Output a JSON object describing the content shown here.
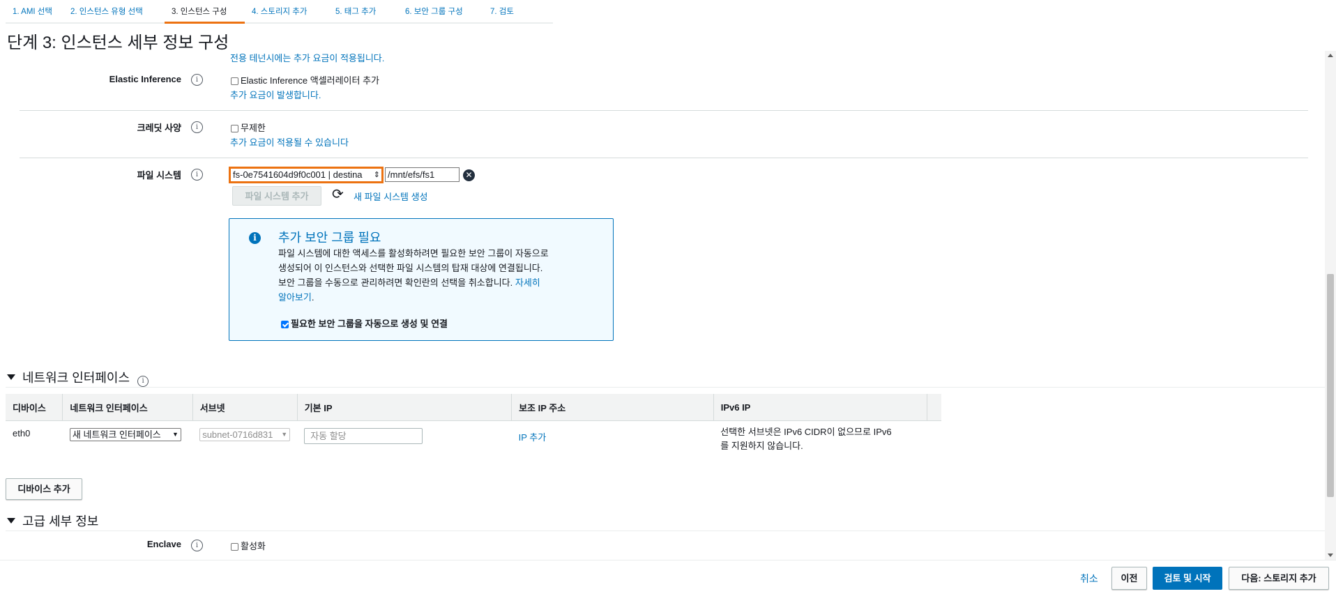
{
  "wizard": {
    "tabs": [
      {
        "label": "1. AMI 선택"
      },
      {
        "label": "2. 인스턴스 유형 선택"
      },
      {
        "label": "3. 인스턴스 구성"
      },
      {
        "label": "4. 스토리지 추가"
      },
      {
        "label": "5. 태그 추가"
      },
      {
        "label": "6. 보안 그룹 구성"
      },
      {
        "label": "7. 검토"
      }
    ],
    "active_index": 2,
    "accent_color": "#ec7211"
  },
  "page_title": "단계 3: 인스턴스 세부 정보 구성",
  "tenancy": {
    "note": "전용 테넌시에는 추가 요금이 적용됩니다."
  },
  "elastic_inference": {
    "label": "Elastic Inference",
    "checkbox_label": "Elastic Inference 액셀러레이터 추가",
    "checked": false,
    "note": "추가 요금이 발생합니다."
  },
  "credit": {
    "label": "크레딧 사양",
    "checkbox_label": "무제한",
    "checked": false,
    "note": "추가 요금이 적용될 수 있습니다"
  },
  "file_system": {
    "label": "파일 시스템",
    "selected": "fs-0e7541604d9f0c001 | destina",
    "mount_path": "/mnt/efs/fs1",
    "add_button": "파일 시스템 추가",
    "create_link": "새 파일 시스템 생성",
    "alert": {
      "title": "추가 보안 그룹 필요",
      "body_lines": [
        "파일 시스템에 대한 액세스를 활성화하려면 필요한 보안 그룹이 자동으로",
        "생성되어 이 인스턴스와 선택한 파일 시스템의 탑재 대상에 연결됩니다.",
        "보안 그룹을 수동으로 관리하려면 확인란의 선택을 취소합니다."
      ],
      "learn_more_1": "자세히",
      "learn_more_2": "알아보기",
      "learn_more_suffix": ".",
      "checkbox_label": "필요한 보안 그룹을 자동으로 생성 및 연결",
      "checked": true
    }
  },
  "network_section": {
    "title": "네트워크 인터페이스",
    "columns": [
      "디바이스",
      "네트워크 인터페이스",
      "서브넷",
      "기본 IP",
      "보조 IP 주소",
      "IPv6 IP"
    ],
    "row": {
      "device": "eth0",
      "interface": "새 네트워크 인터페이스",
      "subnet": "subnet-0716d831",
      "primary_ip_placeholder": "자동 할당",
      "secondary_ip": "IP 추가",
      "ipv6_line1": "선택한 서브넷은 IPv6 CIDR이 없으므로 IPv6",
      "ipv6_line2": "를 지원하지 않습니다."
    },
    "add_device_button": "디바이스 추가"
  },
  "advanced_section": {
    "title": "고급 세부 정보",
    "enclave_label": "Enclave",
    "enclave_checkbox": "활성화",
    "enclave_checked": false
  },
  "footer": {
    "cancel": "취소",
    "previous": "이전",
    "review_launch": "검토 및 시작",
    "next": "다음: 스토리지 추가"
  },
  "colors": {
    "link": "#0073bb",
    "primary": "#0073bb",
    "highlight": "#ec7211"
  }
}
